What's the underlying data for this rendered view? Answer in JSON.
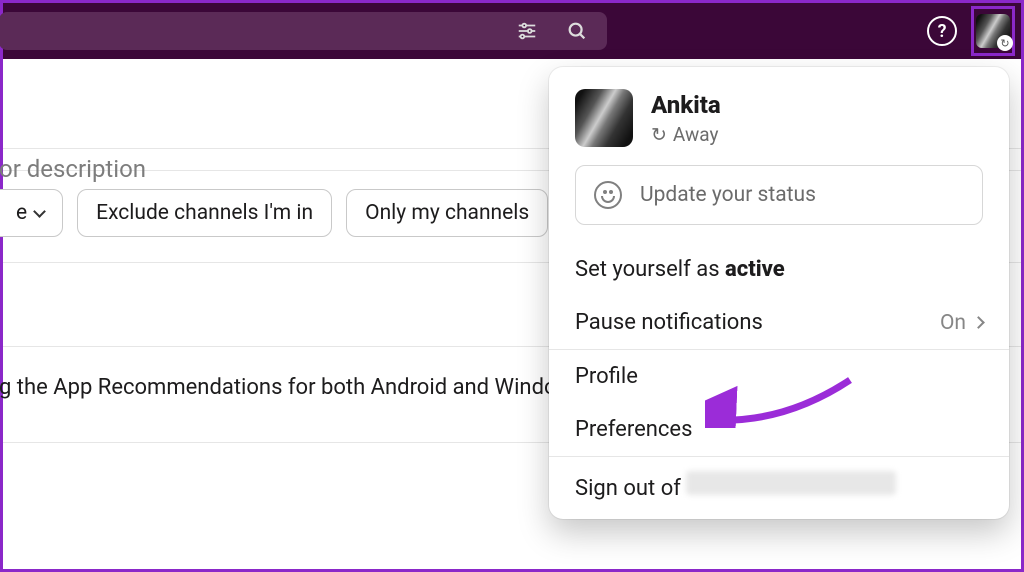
{
  "topbar": {},
  "background": {
    "placeholder": "or description",
    "chip_type_suffix": "e",
    "chip_exclude": "Exclude channels I'm in",
    "chip_only": "Only my channels",
    "desc_fragment": "g the App Recommendations for both Android and Windo"
  },
  "menu": {
    "user_name": "Ankita",
    "presence": "Away",
    "status_placeholder": "Update your status",
    "set_active_prefix": "Set yourself as ",
    "set_active_strong": "active",
    "pause_notifications": "Pause notifications",
    "pause_value": "On",
    "profile": "Profile",
    "preferences": "Preferences",
    "sign_out_prefix": "Sign out of "
  }
}
